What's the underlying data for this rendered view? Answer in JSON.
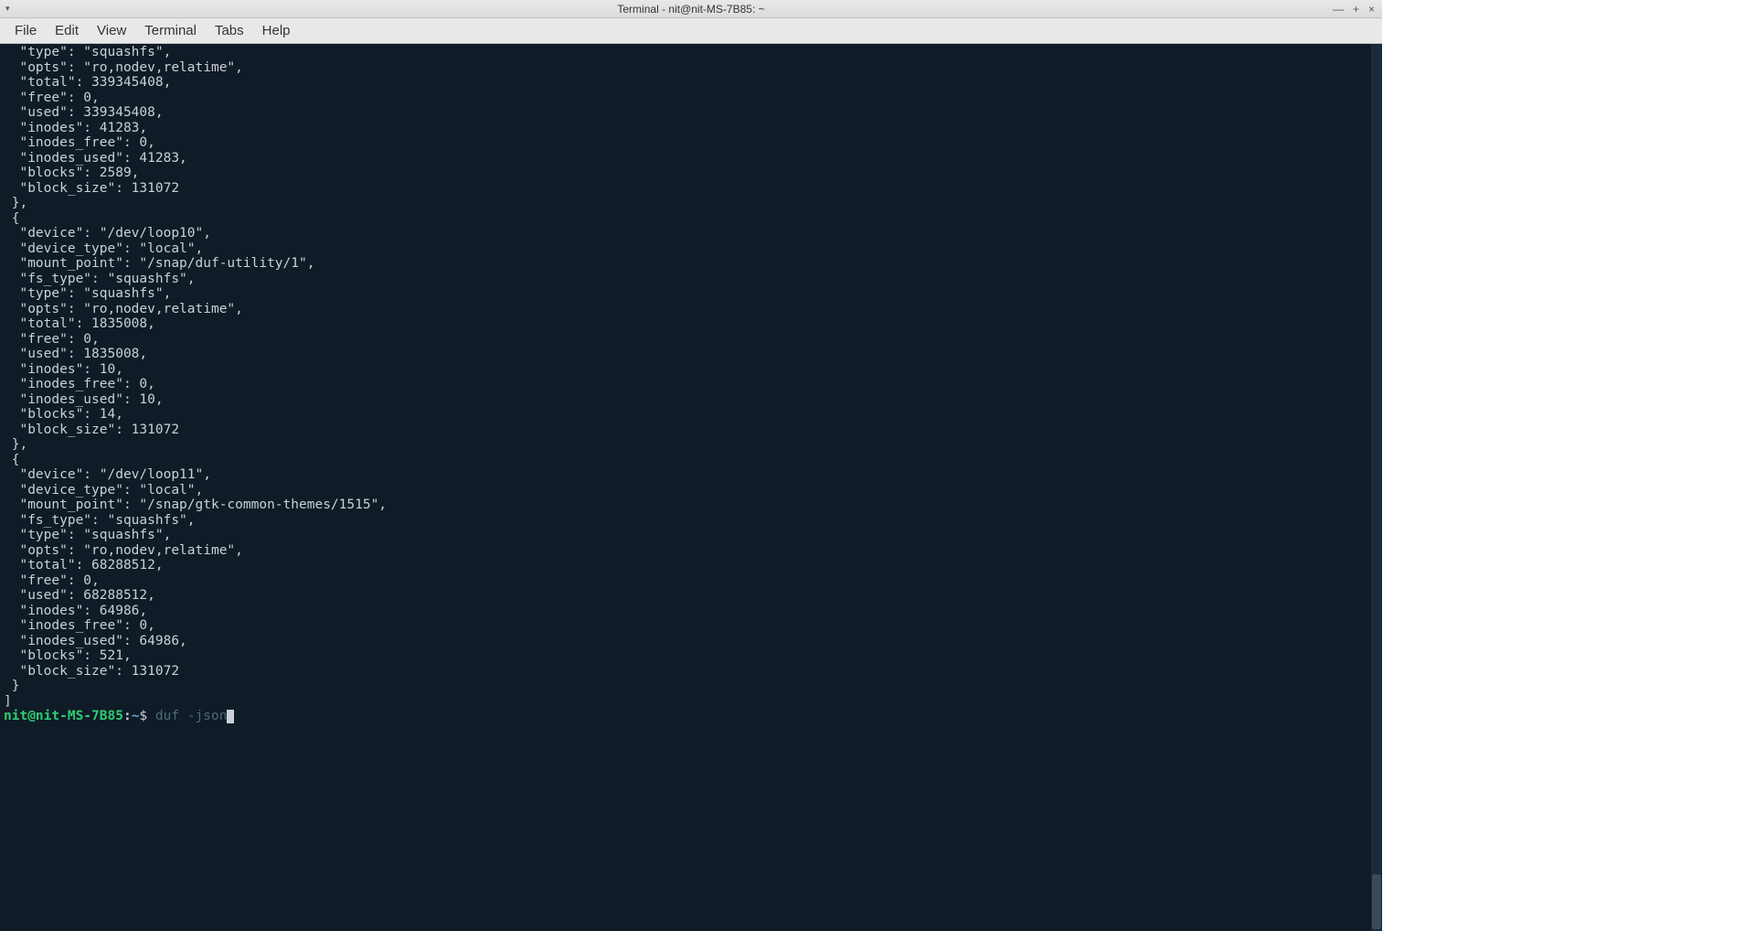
{
  "window": {
    "title": "Terminal - nit@nit-MS-7B85: ~",
    "controls": {
      "minimize": "—",
      "maximize": "+",
      "close": "×"
    }
  },
  "menubar": {
    "items": [
      "File",
      "Edit",
      "View",
      "Terminal",
      "Tabs",
      "Help"
    ]
  },
  "terminal": {
    "output_lines": [
      "  \"type\": \"squashfs\",",
      "  \"opts\": \"ro,nodev,relatime\",",
      "  \"total\": 339345408,",
      "  \"free\": 0,",
      "  \"used\": 339345408,",
      "  \"inodes\": 41283,",
      "  \"inodes_free\": 0,",
      "  \"inodes_used\": 41283,",
      "  \"blocks\": 2589,",
      "  \"block_size\": 131072",
      " },",
      " {",
      "  \"device\": \"/dev/loop10\",",
      "  \"device_type\": \"local\",",
      "  \"mount_point\": \"/snap/duf-utility/1\",",
      "  \"fs_type\": \"squashfs\",",
      "  \"type\": \"squashfs\",",
      "  \"opts\": \"ro,nodev,relatime\",",
      "  \"total\": 1835008,",
      "  \"free\": 0,",
      "  \"used\": 1835008,",
      "  \"inodes\": 10,",
      "  \"inodes_free\": 0,",
      "  \"inodes_used\": 10,",
      "  \"blocks\": 14,",
      "  \"block_size\": 131072",
      " },",
      " {",
      "  \"device\": \"/dev/loop11\",",
      "  \"device_type\": \"local\",",
      "  \"mount_point\": \"/snap/gtk-common-themes/1515\",",
      "  \"fs_type\": \"squashfs\",",
      "  \"type\": \"squashfs\",",
      "  \"opts\": \"ro,nodev,relatime\",",
      "  \"total\": 68288512,",
      "  \"free\": 0,",
      "  \"used\": 68288512,",
      "  \"inodes\": 64986,",
      "  \"inodes_free\": 0,",
      "  \"inodes_used\": 64986,",
      "  \"blocks\": 521,",
      "  \"block_size\": 131072",
      " }",
      "]"
    ],
    "prompt": {
      "user_host": "nit@nit-MS-7B85",
      "separator": ":",
      "path": "~",
      "dollar": "$",
      "command": "duf -json"
    }
  }
}
